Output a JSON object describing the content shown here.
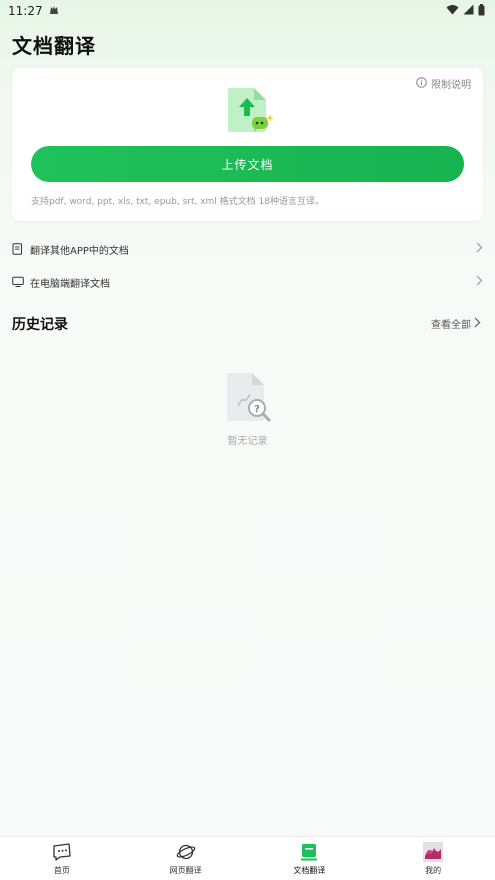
{
  "status": {
    "time": "11:27"
  },
  "page": {
    "title": "文档翻译"
  },
  "upload_card": {
    "limit_label": "限制说明",
    "button_label": "上传文档",
    "support_text": "支持pdf, word, ppt, xls, txt, epub, srt, xml 格式文档 18种语言互译。"
  },
  "menu": [
    {
      "label": "翻译其他APP中的文档",
      "icon": "document-icon"
    },
    {
      "label": "在电脑端翻译文档",
      "icon": "monitor-icon"
    }
  ],
  "history": {
    "title": "历史记录",
    "view_all": "查看全部",
    "empty_text": "暂无记录"
  },
  "bottom_nav": [
    {
      "label": "首页",
      "icon": "chat-icon"
    },
    {
      "label": "网页翻译",
      "icon": "planet-icon"
    },
    {
      "label": "文档翻译",
      "icon": "document-translate-icon",
      "active": true
    },
    {
      "label": "我的",
      "icon": "avatar"
    }
  ],
  "colors": {
    "accent": "#1fc25a",
    "background": "#f7fbf8"
  }
}
